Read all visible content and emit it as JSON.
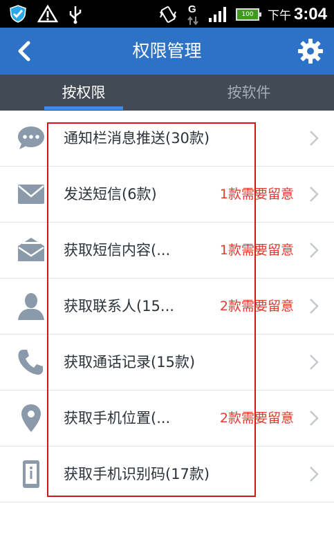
{
  "status_bar": {
    "time_label": "下午",
    "time": "3:04",
    "battery": "100"
  },
  "header": {
    "title": "权限管理"
  },
  "tabs": [
    {
      "label": "按权限",
      "active": true
    },
    {
      "label": "按软件",
      "active": false
    }
  ],
  "colors": {
    "header_bg": "#2e72c8",
    "tab_bg": "#424b55",
    "tab_underline": "#3a8fe0",
    "warning": "#e23a2e",
    "icon": "#8a9aab",
    "highlight_border": "#d6121b"
  },
  "permissions": [
    {
      "icon": "chat-bubble-icon",
      "label": "通知栏消息推送(30款)",
      "warning": ""
    },
    {
      "icon": "envelope-icon",
      "label": "发送短信(6款)",
      "warning": "1款需要留意"
    },
    {
      "icon": "open-envelope-icon",
      "label": "获取短信内容(...",
      "warning": "1款需要留意"
    },
    {
      "icon": "person-icon",
      "label": "获取联系人(15...",
      "warning": "2款需要留意"
    },
    {
      "icon": "phone-icon",
      "label": "获取通话记录(15款)",
      "warning": ""
    },
    {
      "icon": "location-pin-icon",
      "label": "获取手机位置(...",
      "warning": "2款需要留意"
    },
    {
      "icon": "device-id-icon",
      "label": "获取手机识别码(17款)",
      "warning": ""
    }
  ]
}
